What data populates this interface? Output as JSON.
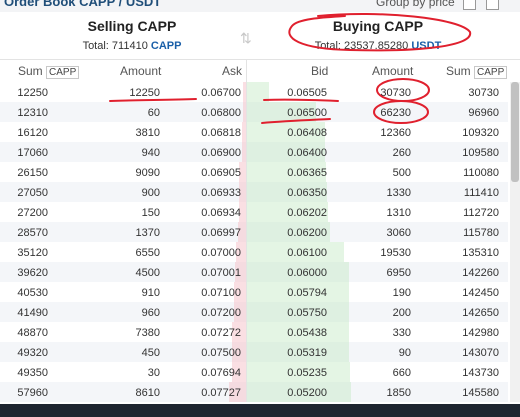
{
  "topbar": {
    "title": "Order Book CAPP / USDT",
    "group_by": "Group by price"
  },
  "selling": {
    "title": "Selling CAPP",
    "total_label": "Total:",
    "total_value": "711410",
    "currency": "CAPP"
  },
  "buying": {
    "title": "Buying CAPP",
    "total_label": "Total:",
    "total_value": "23537.85280",
    "currency": "USDT"
  },
  "columns": {
    "sum": "Sum",
    "sum_tag": "CAPP",
    "amount": "Amount",
    "ask": "Ask",
    "bid": "Bid",
    "amount2": "Amount",
    "sum2": "Sum",
    "sum2_tag": "CAPP"
  },
  "rows": [
    [
      "12250",
      "12250",
      "0.06700",
      "0.06505",
      "30730",
      "30730"
    ],
    [
      "12310",
      "60",
      "0.06800",
      "0.06500",
      "66230",
      "96960"
    ],
    [
      "16120",
      "3810",
      "0.06818",
      "0.06408",
      "12360",
      "109320"
    ],
    [
      "17060",
      "940",
      "0.06900",
      "0.06400",
      "260",
      "109580"
    ],
    [
      "26150",
      "9090",
      "0.06905",
      "0.06365",
      "500",
      "110080"
    ],
    [
      "27050",
      "900",
      "0.06933",
      "0.06350",
      "1330",
      "111410"
    ],
    [
      "27200",
      "150",
      "0.06934",
      "0.06202",
      "1310",
      "112720"
    ],
    [
      "28570",
      "1370",
      "0.06997",
      "0.06200",
      "3060",
      "115780"
    ],
    [
      "35120",
      "6550",
      "0.07000",
      "0.06100",
      "19530",
      "135310"
    ],
    [
      "39620",
      "4500",
      "0.07001",
      "0.06000",
      "6950",
      "142260"
    ],
    [
      "40530",
      "910",
      "0.07100",
      "0.05794",
      "190",
      "142450"
    ],
    [
      "41490",
      "960",
      "0.07200",
      "0.05750",
      "200",
      "142650"
    ],
    [
      "48870",
      "7380",
      "0.07272",
      "0.05438",
      "330",
      "142980"
    ],
    [
      "49320",
      "450",
      "0.07500",
      "0.05319",
      "90",
      "143070"
    ],
    [
      "49350",
      "30",
      "0.07694",
      "0.05235",
      "660",
      "143730"
    ],
    [
      "57960",
      "8610",
      "0.07727",
      "0.05200",
      "1850",
      "145580"
    ]
  ],
  "ask_depth_max": 57960,
  "bid_depth_max": 145580,
  "colors": {
    "ask_bar": "#f6c4cc",
    "bid_bar": "#c4e8c4",
    "annotation": "#e0202e",
    "currency": "#1a5fa8"
  }
}
